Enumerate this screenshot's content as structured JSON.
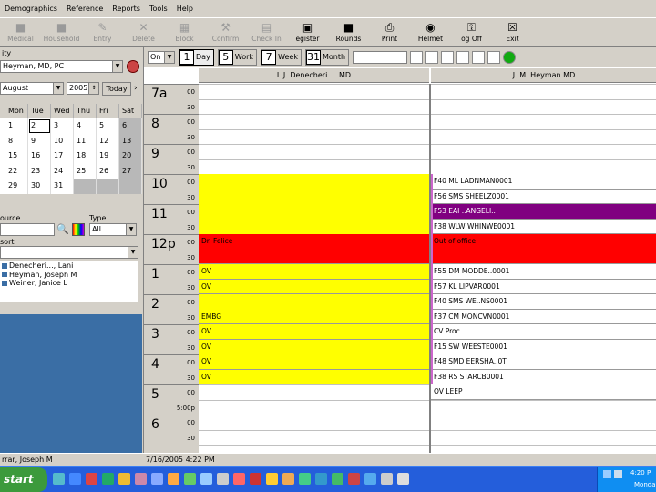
{
  "menu": [
    "Demographics",
    "Reference",
    "Reports",
    "Tools",
    "Help"
  ],
  "toolbar": [
    {
      "label": "Medical",
      "icon": "medical-icon",
      "glyph": "■",
      "disabled": true
    },
    {
      "label": "Household",
      "icon": "household-icon",
      "glyph": "■",
      "disabled": true
    },
    {
      "label": "Entry",
      "icon": "entry-icon",
      "glyph": "✎",
      "disabled": true
    },
    {
      "label": "Delete",
      "icon": "delete-icon",
      "glyph": "✕",
      "disabled": true
    },
    {
      "label": "Block",
      "icon": "block-icon",
      "glyph": "▦",
      "disabled": true
    },
    {
      "label": "Confirm",
      "icon": "confirm-icon",
      "glyph": "⚒",
      "disabled": true
    },
    {
      "label": "Check In",
      "icon": "check-in-icon",
      "glyph": "▤",
      "disabled": true
    },
    {
      "label": "egister",
      "icon": "register-icon",
      "glyph": "▣",
      "disabled": false
    },
    {
      "label": "Rounds",
      "icon": "rounds-icon",
      "glyph": "■",
      "disabled": false
    },
    {
      "label": "Print",
      "icon": "print-icon",
      "glyph": "⎙",
      "disabled": false
    },
    {
      "label": "Helmet",
      "icon": "helmet-icon",
      "glyph": "◉",
      "disabled": false
    },
    {
      "label": "og Off",
      "icon": "log-off-icon",
      "glyph": "⚿",
      "disabled": false
    },
    {
      "label": "Exit",
      "icon": "exit-icon",
      "glyph": "☒",
      "disabled": false
    }
  ],
  "left": {
    "provider_label": "ity",
    "provider_value": "Heyman, MD, PC",
    "month": "August",
    "year": "2005",
    "today_label": "Today",
    "day_headers": [
      "",
      "Mon",
      "Tue",
      "Wed",
      "Thu",
      "Fri",
      "Sat"
    ],
    "weeks": [
      [
        "",
        "1",
        "2",
        "3",
        "4",
        "5",
        "6"
      ],
      [
        "",
        "8",
        "9",
        "10",
        "11",
        "12",
        "13"
      ],
      [
        "",
        "15",
        "16",
        "17",
        "18",
        "19",
        "20"
      ],
      [
        "",
        "22",
        "23",
        "24",
        "25",
        "26",
        "27"
      ],
      [
        "",
        "29",
        "30",
        "31",
        "",
        "",
        ""
      ]
    ],
    "selected_day": "2",
    "source_label": "ource",
    "type_label": "Type",
    "type_value": "All",
    "sort_label": "sort",
    "providers": [
      "Denecheri..., Lani",
      "Heyman, Joseph M",
      "Weiner, Janice L"
    ]
  },
  "schedule": {
    "view_combo": "On",
    "views": [
      {
        "num": "1",
        "label": "Day",
        "active": true
      },
      {
        "num": "5",
        "label": "Work",
        "active": false
      },
      {
        "num": "7",
        "label": "Week",
        "active": false
      },
      {
        "num": "31",
        "label": "Month",
        "active": false
      }
    ],
    "col1_title": "L.J. Denecheri ... MD",
    "col2_title": "J. M. Heyman  MD",
    "hours": [
      "7a",
      "8",
      "9",
      "10",
      "11",
      "12p",
      "1",
      "2",
      "3",
      "4",
      "5",
      "6"
    ],
    "min_labels": [
      "00",
      "30"
    ],
    "last_slot": "5:00p",
    "col2_appts": [
      {
        "slot": 12,
        "text": "F40  ML  LADNMAN0001",
        "bg": "#ffffff"
      },
      {
        "slot": 13,
        "text": "F56  SMS  SHEELZ0001",
        "bg": "#ffffff"
      },
      {
        "slot": 14,
        "text": "F53  EAI  ..ANGELI..",
        "bg": "#800080"
      },
      {
        "slot": 15,
        "text": "F38  WLW  WHINWE0001",
        "bg": "#ffffff"
      },
      {
        "slot": 16,
        "text": "Out of office",
        "bg": "#ff0000"
      },
      {
        "slot": 18,
        "text": "F55  DM  MODDE..0001",
        "bg": "#ffffff"
      },
      {
        "slot": 19,
        "text": "F57  KL  LIPVAR0001",
        "bg": "#ffffff"
      },
      {
        "slot": 20,
        "text": "F40  SMS  WE..NS0001",
        "bg": "#ffffff"
      },
      {
        "slot": 21,
        "text": "F37  CM  MONCVN0001",
        "bg": "#ffffff"
      },
      {
        "slot": 22,
        "text": "CV   Proc",
        "bg": "#ffffff"
      },
      {
        "slot": 23,
        "text": "F15  SW  WEESTE0001",
        "bg": "#ffffff"
      },
      {
        "slot": 24,
        "text": "F48  SMD  EERSHA..0T",
        "bg": "#ffffff"
      },
      {
        "slot": 25,
        "text": "F38  RS  STARCB0001",
        "bg": "#ffffff"
      },
      {
        "slot": 26,
        "text": "OV   LEEP",
        "bg": "#ffffff"
      }
    ],
    "col1_appts": [
      {
        "slot": 16,
        "text": "Dr. Felice",
        "bg": "#ff0000"
      },
      {
        "slot": 18,
        "text": "OV",
        "bg": "#ffff00"
      },
      {
        "slot": 19,
        "text": "OV",
        "bg": "#ffff00"
      },
      {
        "slot": 21,
        "text": "EMBG",
        "bg": "#ffff00"
      },
      {
        "slot": 22,
        "text": "OV",
        "bg": "#ffff00"
      },
      {
        "slot": 23,
        "text": "OV",
        "bg": "#ffff00"
      },
      {
        "slot": 24,
        "text": "OV",
        "bg": "#ffff00"
      },
      {
        "slot": 25,
        "text": "OV",
        "bg": "#ffff00"
      }
    ]
  },
  "status": {
    "user": "rrar, Joseph M",
    "datetime": "7/16/2005 4:22 PM"
  },
  "taskbar": {
    "start_label": "start",
    "clock": "4:20 P",
    "day": "Monda"
  }
}
